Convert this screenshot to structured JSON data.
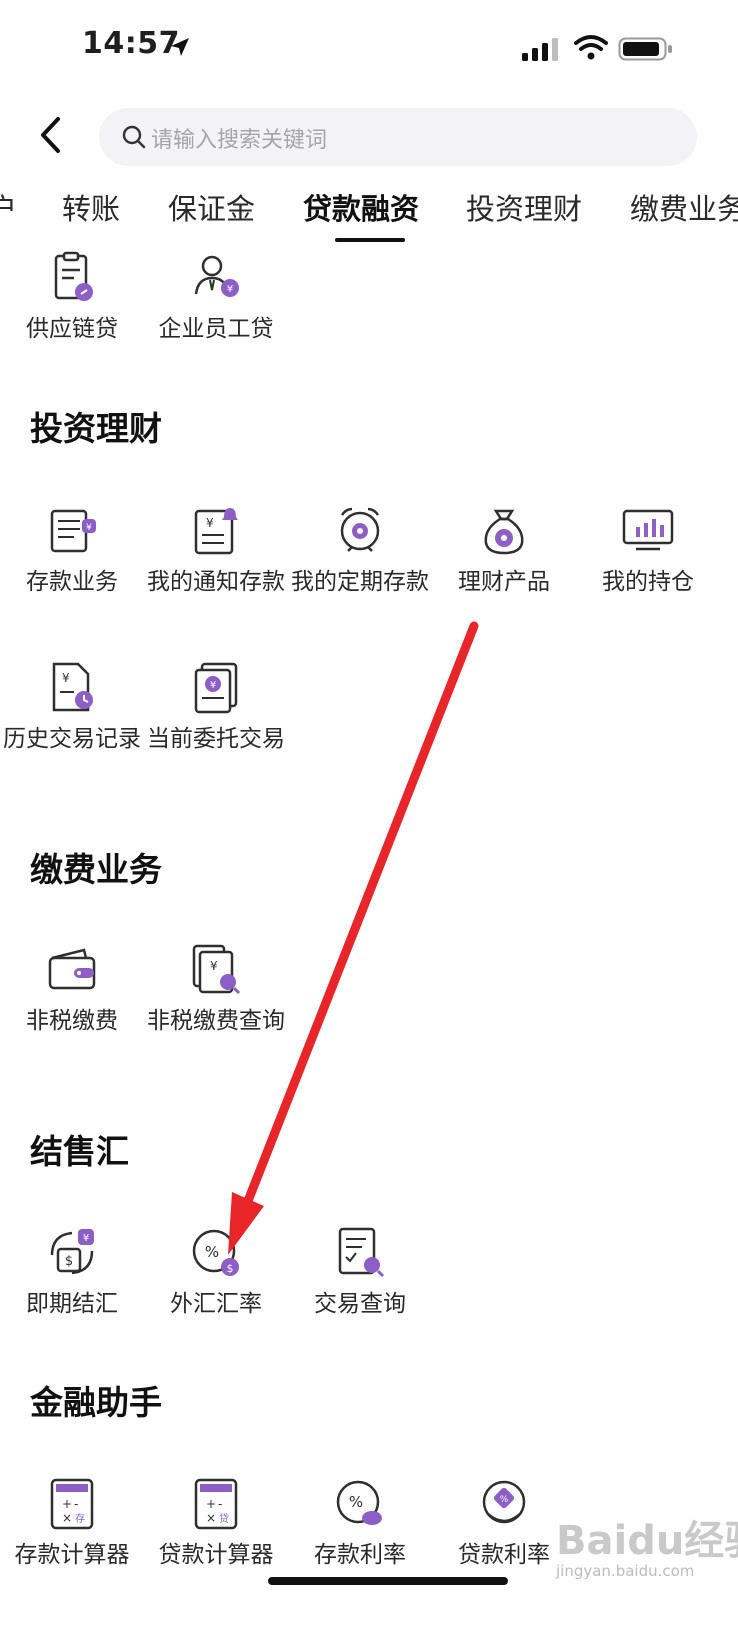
{
  "status_bar": {
    "time": "14:57"
  },
  "search": {
    "placeholder": "请输入搜索关键词"
  },
  "tabs": [
    {
      "label": "户"
    },
    {
      "label": "转账"
    },
    {
      "label": "保证金"
    },
    {
      "label": "贷款融资",
      "active": true
    },
    {
      "label": "投资理财"
    },
    {
      "label": "缴费业务"
    }
  ],
  "loan_section": {
    "items": [
      {
        "label": "供应链贷",
        "icon": "clipboard-link-icon"
      },
      {
        "label": "企业员工贷",
        "icon": "employee-yuan-icon"
      }
    ]
  },
  "invest_section": {
    "title": "投资理财",
    "items": [
      {
        "label": "存款业务",
        "icon": "deposit-doc-icon"
      },
      {
        "label": "我的通知存款",
        "icon": "notice-deposit-icon"
      },
      {
        "label": "我的定期存款",
        "icon": "alarm-clock-icon"
      },
      {
        "label": "理财产品",
        "icon": "money-bag-icon"
      },
      {
        "label": "我的持仓",
        "icon": "monitor-chart-icon"
      },
      {
        "label": "历史交易记录",
        "icon": "history-doc-icon"
      },
      {
        "label": "当前委托交易",
        "icon": "entrust-doc-icon"
      }
    ]
  },
  "fee_section": {
    "title": "缴费业务",
    "items": [
      {
        "label": "非税缴费",
        "icon": "wallet-icon"
      },
      {
        "label": "非税缴费查询",
        "icon": "fee-query-icon"
      }
    ]
  },
  "fx_section": {
    "title": "结售汇",
    "items": [
      {
        "label": "即期结汇",
        "icon": "exchange-dollar-icon"
      },
      {
        "label": "外汇汇率",
        "icon": "fx-rate-icon"
      },
      {
        "label": "交易查询",
        "icon": "transaction-query-icon"
      }
    ]
  },
  "assistant_section": {
    "title": "金融助手",
    "items": [
      {
        "label": "存款计算器",
        "icon": "deposit-calculator-icon"
      },
      {
        "label": "贷款计算器",
        "icon": "loan-calculator-icon"
      },
      {
        "label": "存款利率",
        "icon": "deposit-rate-icon"
      },
      {
        "label": "贷款利率",
        "icon": "loan-rate-icon"
      }
    ]
  },
  "watermark": {
    "logo": "Baidu经验",
    "site": "jingyan.baidu.com"
  },
  "colors": {
    "accent": "#8e5ec7",
    "icon_stroke": "#2f2f2f",
    "annotation_arrow": "#e8262a"
  }
}
